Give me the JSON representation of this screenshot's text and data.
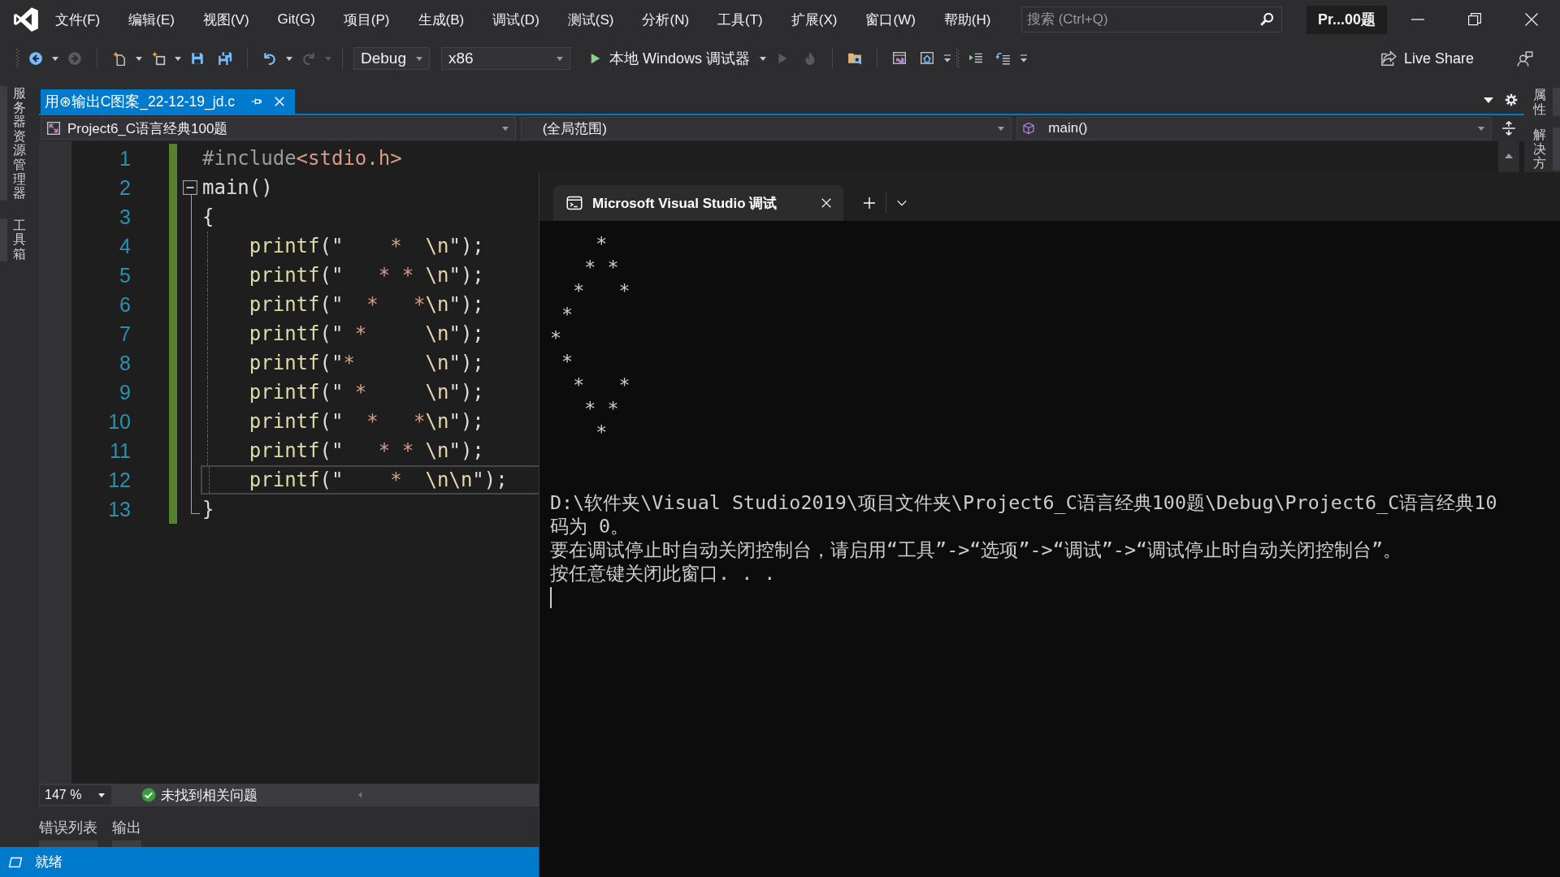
{
  "menu_bar": {
    "items": [
      "文件(F)",
      "编辑(E)",
      "视图(V)",
      "Git(G)",
      "项目(P)",
      "生成(B)",
      "调试(D)",
      "测试(S)",
      "分析(N)",
      "工具(T)",
      "扩展(X)",
      "窗口(W)",
      "帮助(H)"
    ],
    "search": {
      "placeholder": "搜索 (Ctrl+Q)"
    },
    "solution_name": "Pr...00题"
  },
  "toolbar": {
    "items": [
      {
        "kind": "grip"
      },
      {
        "kind": "back",
        "disabled": false,
        "dropdown": true
      },
      {
        "kind": "forward",
        "disabled": true,
        "dropdown": false
      },
      {
        "kind": "separator"
      },
      {
        "kind": "new-project",
        "disabled": false,
        "dropdown": true
      },
      {
        "kind": "add-item",
        "disabled": false,
        "dropdown": true
      },
      {
        "kind": "save",
        "disabled": false,
        "dropdown": false
      },
      {
        "kind": "save-all",
        "disabled": false,
        "dropdown": false
      },
      {
        "kind": "separator"
      },
      {
        "kind": "undo",
        "disabled": false,
        "dropdown": true
      },
      {
        "kind": "redo",
        "disabled": true,
        "dropdown": true
      },
      {
        "kind": "separator"
      },
      {
        "kind": "combo",
        "value": "Debug",
        "disabled": false
      },
      {
        "kind": "combo",
        "value": "x86",
        "disabled": false
      },
      {
        "kind": "run",
        "label": "本地 Windows 调试器",
        "disabled": false,
        "dropdown": true
      },
      {
        "kind": "start-without-debugging",
        "disabled": true,
        "dropdown": false
      },
      {
        "kind": "hot-reload",
        "disabled": true,
        "dropdown": false
      },
      {
        "kind": "separator"
      },
      {
        "kind": "find-in-files",
        "disabled": false,
        "dropdown": false
      },
      {
        "kind": "separator"
      },
      {
        "kind": "window",
        "disabled": false,
        "dropdown": false
      },
      {
        "kind": "home",
        "disabled": false,
        "dropdown": false
      },
      {
        "kind": "overflow"
      },
      {
        "kind": "grip"
      },
      {
        "kind": "indent",
        "disabled": false,
        "dropdown": false
      },
      {
        "kind": "outdent",
        "disabled": false,
        "dropdown": false
      },
      {
        "kind": "overflow"
      }
    ],
    "live_share": "Live Share"
  },
  "left_tool_tabs": [
    "服务器资源管理器",
    "工具箱"
  ],
  "right_tool_tabs": [
    "属性",
    "解决方"
  ],
  "document_tabs": [
    {
      "title": "用⊛输出C图案_22-12-19_jd.c",
      "selected": true
    }
  ],
  "navigation_bar": {
    "project": "Project6_C语言经典100题",
    "scope": "(全局范围)",
    "member": "main()"
  },
  "editor": {
    "lines": [
      {
        "number": "1",
        "current": false,
        "tokens": [
          {
            "kind": "preprocessor",
            "text": "#include"
          },
          {
            "kind": "include-path",
            "text": "<stdio.h>"
          }
        ]
      },
      {
        "number": "2",
        "current": false,
        "fold": {
          "expanded": true
        },
        "tokens": [
          {
            "kind": "plain",
            "text": "main()"
          }
        ]
      },
      {
        "number": "3",
        "current": false,
        "tokens": [
          {
            "kind": "plain",
            "text": "{"
          }
        ]
      },
      {
        "number": "4",
        "current": false,
        "tokens": [
          {
            "kind": "function",
            "text": "    printf"
          },
          {
            "kind": "plain",
            "text": "(\""
          },
          {
            "kind": "string",
            "text": "    *  "
          },
          {
            "kind": "escape",
            "text": "\\n"
          },
          {
            "kind": "plain",
            "text": "\");"
          }
        ]
      },
      {
        "number": "5",
        "current": false,
        "tokens": [
          {
            "kind": "function",
            "text": "    printf"
          },
          {
            "kind": "plain",
            "text": "(\""
          },
          {
            "kind": "string",
            "text": "   * * "
          },
          {
            "kind": "escape",
            "text": "\\n"
          },
          {
            "kind": "plain",
            "text": "\");"
          }
        ]
      },
      {
        "number": "6",
        "current": false,
        "tokens": [
          {
            "kind": "function",
            "text": "    printf"
          },
          {
            "kind": "plain",
            "text": "(\""
          },
          {
            "kind": "string",
            "text": "  *   *"
          },
          {
            "kind": "escape",
            "text": "\\n"
          },
          {
            "kind": "plain",
            "text": "\");"
          }
        ]
      },
      {
        "number": "7",
        "current": false,
        "tokens": [
          {
            "kind": "function",
            "text": "    printf"
          },
          {
            "kind": "plain",
            "text": "(\""
          },
          {
            "kind": "string",
            "text": " *     "
          },
          {
            "kind": "escape",
            "text": "\\n"
          },
          {
            "kind": "plain",
            "text": "\");"
          }
        ]
      },
      {
        "number": "8",
        "current": false,
        "tokens": [
          {
            "kind": "function",
            "text": "    printf"
          },
          {
            "kind": "plain",
            "text": "(\""
          },
          {
            "kind": "string",
            "text": "*      "
          },
          {
            "kind": "escape",
            "text": "\\n"
          },
          {
            "kind": "plain",
            "text": "\");"
          }
        ]
      },
      {
        "number": "9",
        "current": false,
        "tokens": [
          {
            "kind": "function",
            "text": "    printf"
          },
          {
            "kind": "plain",
            "text": "(\""
          },
          {
            "kind": "string",
            "text": " *     "
          },
          {
            "kind": "escape",
            "text": "\\n"
          },
          {
            "kind": "plain",
            "text": "\");"
          }
        ]
      },
      {
        "number": "10",
        "current": false,
        "tokens": [
          {
            "kind": "function",
            "text": "    printf"
          },
          {
            "kind": "plain",
            "text": "(\""
          },
          {
            "kind": "string",
            "text": "  *   *"
          },
          {
            "kind": "escape",
            "text": "\\n"
          },
          {
            "kind": "plain",
            "text": "\");"
          }
        ]
      },
      {
        "number": "11",
        "current": false,
        "tokens": [
          {
            "kind": "function",
            "text": "    printf"
          },
          {
            "kind": "plain",
            "text": "(\""
          },
          {
            "kind": "string",
            "text": "   * * "
          },
          {
            "kind": "escape",
            "text": "\\n"
          },
          {
            "kind": "plain",
            "text": "\");"
          }
        ]
      },
      {
        "number": "12",
        "current": true,
        "tokens": [
          {
            "kind": "function",
            "text": "    printf"
          },
          {
            "kind": "plain",
            "text": "(\""
          },
          {
            "kind": "string",
            "text": "    *  "
          },
          {
            "kind": "escape",
            "text": "\\n\\n"
          },
          {
            "kind": "plain",
            "text": "\");"
          }
        ]
      },
      {
        "number": "13",
        "current": false,
        "tokens": [
          {
            "kind": "plain",
            "text": "}"
          }
        ]
      }
    ],
    "zoom": "147 %",
    "issues": "未找到相关问题"
  },
  "bottom_tool_tabs": [
    "错误列表",
    "输出"
  ],
  "status_bar": {
    "text": "就绪"
  },
  "console": {
    "tabs": [
      {
        "title": "Microsoft Visual Studio 调试",
        "selected": true
      }
    ],
    "output": "    *\n   * *\n  *   *\n *\n*\n *\n  *   *\n   * *\n    *",
    "messages": [
      "D:\\软件夹\\Visual Studio2019\\项目文件夹\\Project6_C语言经典100题\\Debug\\Project6_C语言经典10",
      "码为 0。",
      "要在调试停止时自动关闭控制台，请启用“工具”->“选项”->“调试”->“调试停止时自动关闭控制台”。",
      "按任意键关闭此窗口. . ."
    ]
  }
}
